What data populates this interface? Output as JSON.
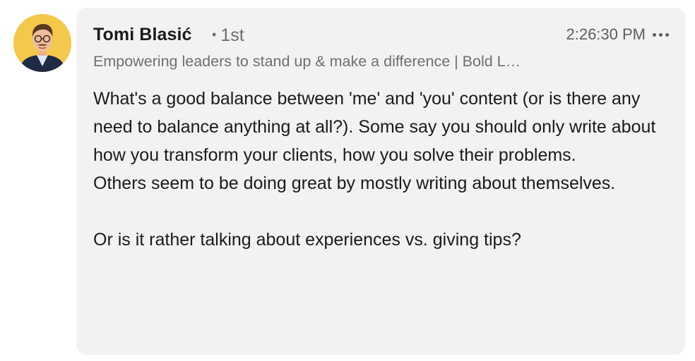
{
  "author": {
    "name": "Tomi Blasić",
    "connection_dot": "•",
    "connection_degree": "1st",
    "headline": "Empowering leaders to stand up & make a difference | Bold L…"
  },
  "timestamp": "2:26:30 PM",
  "more_icon": "more-horizontal-icon",
  "message": {
    "paragraph_1": "What's a good balance between 'me' and 'you' content (or is there any need to balance anything at all?). Some say you should only write about how you transform your clients, how you solve their problems.",
    "paragraph_2": "Others seem to be doing great by mostly writing about themselves.",
    "paragraph_3": "Or is it rather talking about experiences vs. giving tips?"
  },
  "colors": {
    "bubble_background": "#f2f2f2",
    "avatar_background": "#f4c84a",
    "primary_text": "#1b1b1b",
    "secondary_text": "#6f6f6f"
  }
}
